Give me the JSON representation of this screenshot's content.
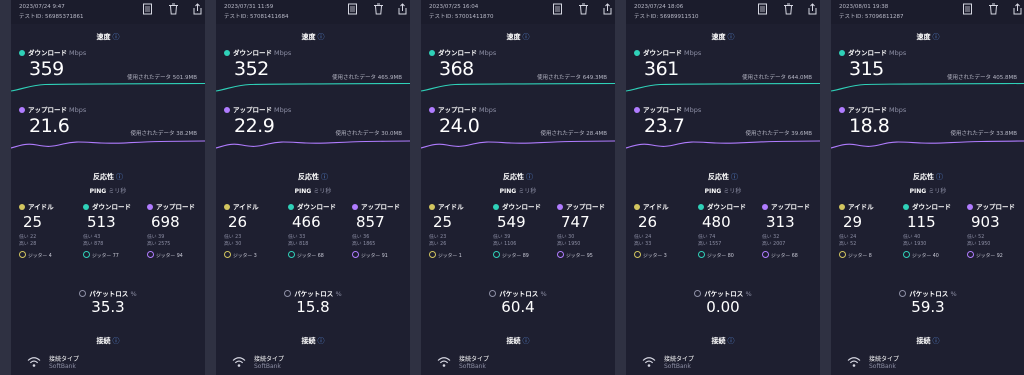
{
  "labels": {
    "speed": "速度",
    "download": "ダウンロード",
    "upload": "アップロード",
    "unit_mbps": "Mbps",
    "data_used": "使用されたデータ",
    "responsiveness": "反応性",
    "ping": "PING",
    "ping_unit": "ミリ秒",
    "idle": "アイドル",
    "low": "低い",
    "high": "高い",
    "jitter": "ジッター",
    "packet_loss": "パケットロス",
    "percent": "%",
    "connection": "接続",
    "connection_type": "接続タイプ",
    "info_glyph": "ⓘ"
  },
  "colors": {
    "download": "#2fd1b8",
    "upload": "#b07cff",
    "idle": "#d2c55f",
    "panel": "#1e1f30",
    "background": "#2b2d3d"
  },
  "icons": [
    "document-icon",
    "trash-icon",
    "share-icon",
    "wifi-icon",
    "info-icon"
  ],
  "results": [
    {
      "date": "2023/07/24 9:47",
      "test_id": "テストID: 56985371861",
      "download": "359",
      "download_used": "501.9MB",
      "upload": "21.6",
      "upload_used": "38.2MB",
      "idle": "25",
      "idle_low": "22",
      "idle_high": "28",
      "idle_jitter": "4",
      "ping_down": "513",
      "ping_down_low": "43",
      "ping_down_high": "878",
      "ping_down_jitter": "77",
      "ping_up": "698",
      "ping_up_low": "39",
      "ping_up_high": "2575",
      "ping_up_jitter": "94",
      "packet_loss": "35.3",
      "provider": "SoftBank"
    },
    {
      "date": "2023/07/31 11:59",
      "test_id": "テストID: 57081411684",
      "download": "352",
      "download_used": "465.9MB",
      "upload": "22.9",
      "upload_used": "30.0MB",
      "idle": "26",
      "idle_low": "23",
      "idle_high": "30",
      "idle_jitter": "3",
      "ping_down": "466",
      "ping_down_low": "33",
      "ping_down_high": "818",
      "ping_down_jitter": "68",
      "ping_up": "857",
      "ping_up_low": "36",
      "ping_up_high": "1865",
      "ping_up_jitter": "91",
      "packet_loss": "15.8",
      "provider": "SoftBank"
    },
    {
      "date": "2023/07/25 16:04",
      "test_id": "テストID: 57001411870",
      "download": "368",
      "download_used": "649.3MB",
      "upload": "24.0",
      "upload_used": "28.4MB",
      "idle": "25",
      "idle_low": "23",
      "idle_high": "26",
      "idle_jitter": "1",
      "ping_down": "549",
      "ping_down_low": "39",
      "ping_down_high": "1106",
      "ping_down_jitter": "89",
      "ping_up": "747",
      "ping_up_low": "30",
      "ping_up_high": "1950",
      "ping_up_jitter": "95",
      "packet_loss": "60.4",
      "provider": "SoftBank"
    },
    {
      "date": "2023/07/24 18:06",
      "test_id": "テストID: 56989911510",
      "download": "361",
      "download_used": "644.0MB",
      "upload": "23.7",
      "upload_used": "39.6MB",
      "idle": "26",
      "idle_low": "24",
      "idle_high": "33",
      "idle_jitter": "3",
      "ping_down": "480",
      "ping_down_low": "74",
      "ping_down_high": "1557",
      "ping_down_jitter": "80",
      "ping_up": "313",
      "ping_up_low": "32",
      "ping_up_high": "2007",
      "ping_up_jitter": "68",
      "packet_loss": "0.00",
      "provider": "SoftBank"
    },
    {
      "date": "2023/08/01 19:38",
      "test_id": "テストID: 57096811287",
      "download": "315",
      "download_used": "405.8MB",
      "upload": "18.8",
      "upload_used": "33.8MB",
      "idle": "29",
      "idle_low": "24",
      "idle_high": "52",
      "idle_jitter": "8",
      "ping_down": "115",
      "ping_down_low": "40",
      "ping_down_high": "1930",
      "ping_down_jitter": "40",
      "ping_up": "903",
      "ping_up_low": "52",
      "ping_up_high": "1950",
      "ping_up_jitter": "92",
      "packet_loss": "59.3",
      "provider": "SoftBank"
    }
  ]
}
